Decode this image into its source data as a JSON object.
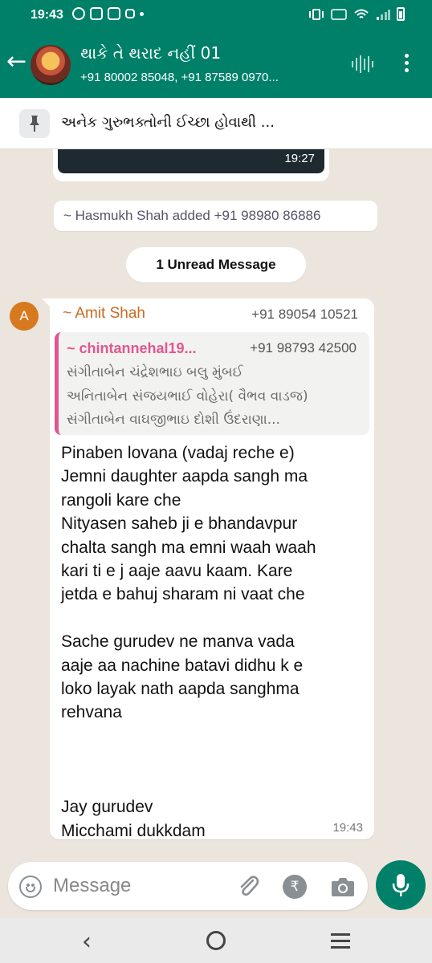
{
  "status_bar": {
    "time": "19:43"
  },
  "header": {
    "back_icon": "arrow-left-icon",
    "title": "થાકે તે થરાદ નહીં 01",
    "subtitle": "+91 80002 85048, +91 87589 0970..."
  },
  "pinned": {
    "text": "અનેક ગુરુભક્તોની ઈચ્છા હોવાથી ..."
  },
  "chat": {
    "media_time": "19:27",
    "system_added": "~ Hasmukh Shah added +91 98980 86886",
    "unread_label": "1 Unread Message",
    "message": {
      "avatar_letter": "A",
      "sender": "~ Amit Shah",
      "sender_phone": "+91 89054 10521",
      "quote": {
        "sender": "~ chintannehal19...",
        "phone": "+91 98793 42500",
        "lines": [
          "સંગીતાબેન ચંદ્રેશભાઇ બલુ મુંબઈ",
          "અનિતાબેન સંજયભાઈ વોહેરા( વૈભવ વાડજ)",
          "સંગીતાબેન વાઘજીભાઇ દોશી ઉંદરાણા..."
        ]
      },
      "body": "Pinaben lovana (vadaj reche e)\nJemni daughter aapda sangh ma\nrangoli kare che\nNityasen saheb ji e bhandavpur\nchalta sangh ma emni waah waah\nkari ti e j aaje aavu kaam. Kare\njetda e bahuj sharam ni vaat che\n\nSache gurudev ne manva vada\naaje aa nachine batavi didhu k e\nloko layak nath aapda sanghma\nrehvana\n\n\n\nJay gurudev\nMicchami dukkdam",
      "time": "19:43"
    }
  },
  "input": {
    "placeholder": "Message",
    "value": "",
    "rupee_symbol": "₹"
  },
  "colors": {
    "header": "#008069",
    "chat_bg": "#ece5dd",
    "sender_name": "#c86b22",
    "quote_accent": "#e05690"
  }
}
